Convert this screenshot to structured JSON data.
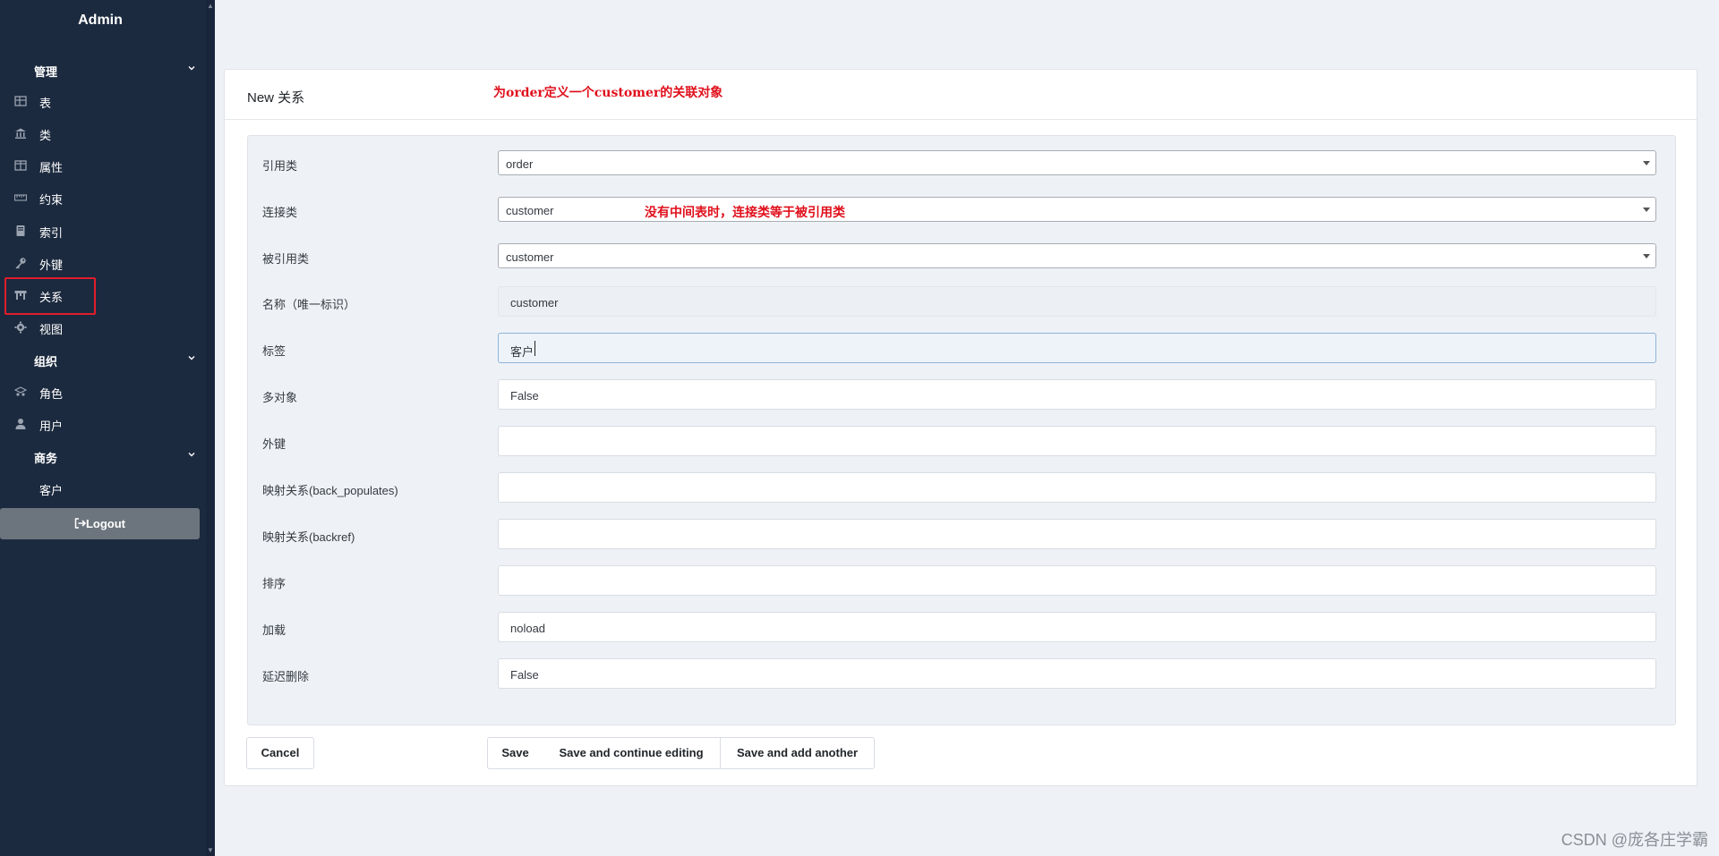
{
  "sidebar": {
    "brand": "Admin",
    "groups": [
      {
        "label": "管理"
      },
      {
        "label": "组织"
      },
      {
        "label": "商务"
      }
    ],
    "items": [
      {
        "label": "表",
        "icon": "table-icon"
      },
      {
        "label": "类",
        "icon": "bank-icon"
      },
      {
        "label": "属性",
        "icon": "columns-icon"
      },
      {
        "label": "约束",
        "icon": "ruler-icon"
      },
      {
        "label": "索引",
        "icon": "book-icon"
      },
      {
        "label": "外键",
        "icon": "key-icon"
      },
      {
        "label": "关系",
        "icon": "archway-icon"
      },
      {
        "label": "视图",
        "icon": "gear-icon"
      },
      {
        "label": "角色",
        "icon": "users-hat-icon"
      },
      {
        "label": "用户",
        "icon": "user-icon"
      },
      {
        "label": "客户",
        "icon": ""
      }
    ],
    "logout": "Logout"
  },
  "card": {
    "title": "New 关系",
    "annotation_top": "为order定义一个customer的关联对象",
    "annotation_join": "没有中间表时，连接类等于被引用类"
  },
  "form": {
    "fields": [
      {
        "label": "引用类",
        "value": "order",
        "type": "select"
      },
      {
        "label": "连接类",
        "value": "customer",
        "type": "select"
      },
      {
        "label": "被引用类",
        "value": "customer",
        "type": "select"
      },
      {
        "label": "名称（唯一标识）",
        "value": "customer",
        "type": "readonly"
      },
      {
        "label": "标签",
        "value": "客户",
        "type": "text-focused"
      },
      {
        "label": "多对象",
        "value": "False",
        "type": "text"
      },
      {
        "label": "外键",
        "value": "",
        "type": "text"
      },
      {
        "label": "映射关系(back_populates)",
        "value": "",
        "type": "text"
      },
      {
        "label": "映射关系(backref)",
        "value": "",
        "type": "text"
      },
      {
        "label": "排序",
        "value": "",
        "type": "text"
      },
      {
        "label": "加载",
        "value": "noload",
        "type": "text"
      },
      {
        "label": "延迟删除",
        "value": "False",
        "type": "text"
      }
    ]
  },
  "buttons": {
    "cancel": "Cancel",
    "save": "Save",
    "save_continue": "Save and continue editing",
    "save_add": "Save and add another"
  },
  "watermark": "CSDN @庞各庄学霸",
  "colors": {
    "sidebar_bg": "#1c2a3f",
    "annotation": "#e0101c",
    "highlight_box": "#e11d2b",
    "logout_bg": "#6c757d"
  }
}
